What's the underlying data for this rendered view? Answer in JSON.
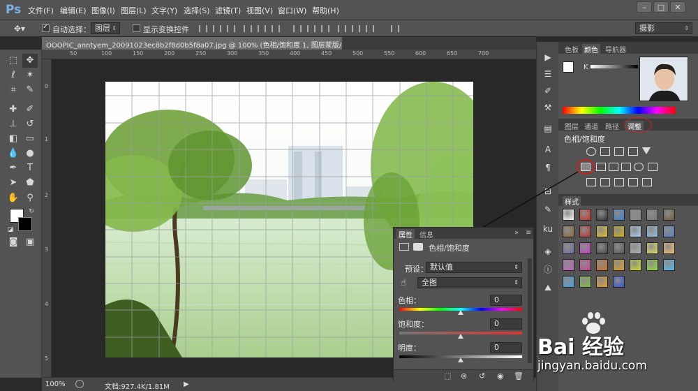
{
  "app": {
    "logo": "Ps"
  },
  "menu": [
    "文件(F)",
    "编辑(E)",
    "图像(I)",
    "图层(L)",
    "文字(Y)",
    "选择(S)",
    "滤镜(T)",
    "视图(V)",
    "窗口(W)",
    "帮助(H)"
  ],
  "window_buttons": [
    "–",
    "□",
    "✕"
  ],
  "options": {
    "auto_select_label": "自动选择：",
    "auto_select_value": "图层",
    "show_transform_label": "显示变换控件",
    "workspace": "摄影"
  },
  "document": {
    "tab_title": "OOOPIC_anntyem_20091023ec8b2f8d0b5f8a07.jpg @ 100% (色相/饱和度 1, 图层蒙版/8) *",
    "close": "×"
  },
  "ruler_top": [
    "50",
    "100",
    "150",
    "200",
    "250",
    "300",
    "350",
    "400",
    "450",
    "500",
    "550",
    "600",
    "650",
    "700"
  ],
  "ruler_left": [
    "0",
    "1",
    "2",
    "3",
    "4",
    "5"
  ],
  "status": {
    "zoom": "100%",
    "doc": "文档:927.4K/1.81M"
  },
  "color_panel": {
    "tabs": [
      "色板",
      "颜色",
      "导航器"
    ],
    "active": 1,
    "channel": "K"
  },
  "adjust_panel": {
    "tabs": [
      "图层",
      "通道",
      "路径",
      "调整"
    ],
    "active": 3,
    "heading": "色相/饱和度"
  },
  "styles_panel": {
    "tab": "样式"
  },
  "properties": {
    "tabs": [
      "属性",
      "信息"
    ],
    "title": "色相/饱和度",
    "preset_label": "预设：",
    "preset_value": "默认值",
    "range_value": "全图",
    "hue_label": "色相：",
    "hue_value": "0",
    "saturation_label": "饱和度：",
    "saturation_value": "0",
    "lightness_label": "明度：",
    "lightness_value": "0"
  },
  "watermark": {
    "brand": "Bai 经验",
    "url": "jingyan.baidu.com"
  },
  "colors": {
    "accent_red": "#cc2222",
    "panel": "#535353",
    "dark": "#2b2b2b"
  }
}
